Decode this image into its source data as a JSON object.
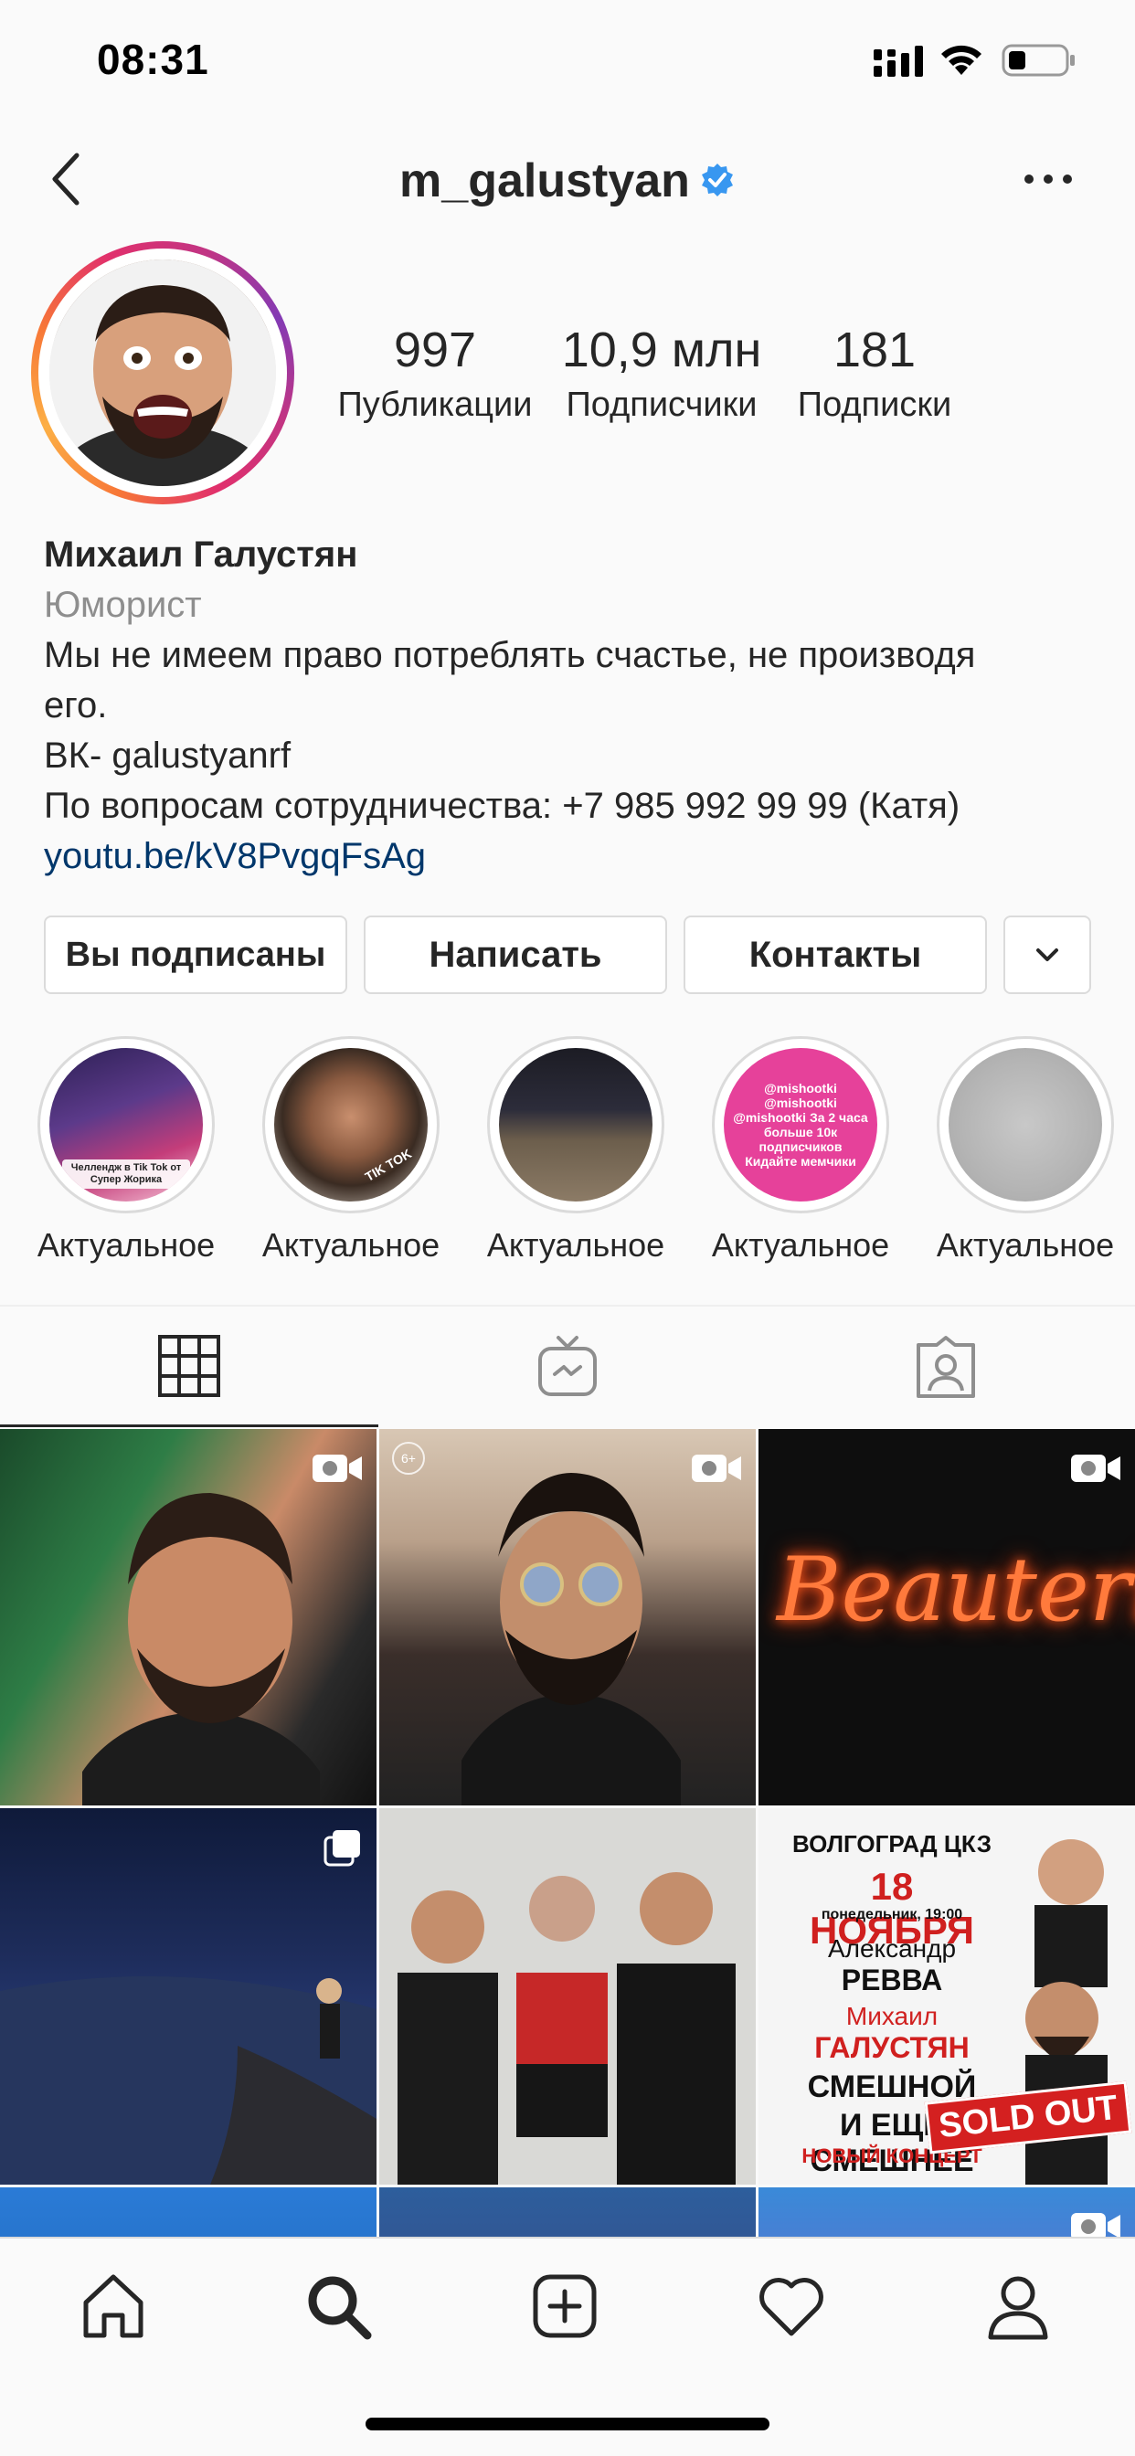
{
  "status_bar": {
    "time": "08:31"
  },
  "header": {
    "username": "m_galustyan",
    "verified": true
  },
  "stats": [
    {
      "value": "997",
      "label": "Публикации"
    },
    {
      "value": "10,9 млн",
      "label": "Подписчики"
    },
    {
      "value": "181",
      "label": "Подписки"
    }
  ],
  "bio": {
    "name": "Михаил Галустян",
    "category": "Юморист",
    "line1": "Мы не имеем право потреблять счастье, не производя",
    "line2": "его.",
    "line3": "ВК- galustyanrf",
    "line4": "По вопросам сотрудничества: +7 985 992 99 99 (Катя)",
    "link": "youtu.be/kV8PvgqFsAg"
  },
  "buttons": {
    "following": "Вы подписаны",
    "message": "Написать",
    "contacts": "Контакты"
  },
  "highlights": [
    {
      "label": "Актуальное",
      "caption": "Челлендж в Tik Tok от Супер Жорика"
    },
    {
      "label": "Актуальное",
      "caption": "TIK TOK"
    },
    {
      "label": "Актуальное",
      "caption": ""
    },
    {
      "label": "Актуальное",
      "caption": "@mishootki @mishootki @mishootki За 2 часа больше 10к подписчиков Кидайте мемчики"
    },
    {
      "label": "Актуальное",
      "caption": ""
    }
  ],
  "grid": {
    "neon_text": "Beauteria",
    "age_badge": "6+",
    "poster": {
      "city": "ВОЛГОГРАД ЦКЗ",
      "date": "18 НОЯБРЯ",
      "date_sub": "понедельник, 19:00",
      "artist1_first": "Александр",
      "artist1_last": "РЕВВА",
      "artist2_first": "Михаил",
      "artist2_last": "ГАЛУСТЯН",
      "title1": "СМЕШНОЙ",
      "title2": "И ЕЩЁ СМЕШНЕЕ",
      "title3": "НОВЫЙ КОНЦЕРТ",
      "soldout": "SOLD OUT"
    }
  },
  "colors": {
    "link": "#00376b",
    "verified": "#3897f0",
    "muted": "#8e8e8e"
  }
}
